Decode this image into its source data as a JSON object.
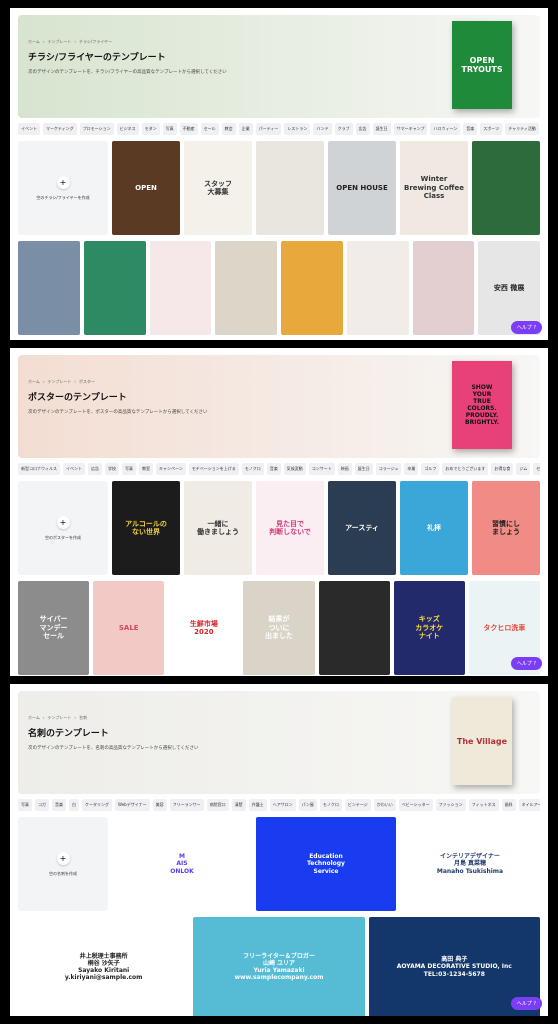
{
  "panels": [
    {
      "crumbs": [
        "ホーム",
        "›",
        "テンプレート",
        "›",
        "チラシ/フライヤー"
      ],
      "title": "チラシ/フライヤーのテンプレート",
      "subtitle": "次のデザインのテンプレートを、チラシ/フライヤーの高品質なテンプレートから選択してください",
      "banner_bg": "#d7e4cf",
      "hero": {
        "text": "OPEN\nTRYOUTS",
        "bg": "#1f8a3a",
        "color": "#ffffff"
      },
      "tags": [
        "イベント",
        "マーケティング",
        "プロモーション",
        "ビジネス",
        "モダン",
        "写真",
        "不動産",
        "セール",
        "教会",
        "企業",
        "パーティー",
        "レストラン",
        "バンド",
        "クラブ",
        "広告",
        "誕生日",
        "サマーキャンプ",
        "ハロウィーン",
        "音楽",
        "スポーツ",
        "チャリティ活動",
        "ポス"
      ],
      "create_label": "空のチラシ/フライヤーを作成",
      "row1": [
        {
          "text": "OPEN",
          "bg": "#5a3a22",
          "color": "#fff"
        },
        {
          "text": "スタッフ\n大募集",
          "bg": "#f4f1ea",
          "color": "#333"
        },
        {
          "text": "",
          "bg": "#e9e6e0",
          "color": "#333"
        },
        {
          "text": "OPEN HOUSE",
          "bg": "#cfd3d6",
          "color": "#222"
        },
        {
          "text": "Winter\nBrewing Coffee Class",
          "bg": "#efe9e1",
          "color": "#333"
        },
        {
          "text": "",
          "bg": "#2e6b3a",
          "color": "#fff"
        }
      ],
      "row2": [
        {
          "text": "",
          "bg": "#7a8ea6",
          "color": "#fff"
        },
        {
          "text": "",
          "bg": "#2e8a62",
          "color": "#fff"
        },
        {
          "text": "",
          "bg": "#f6e7e9",
          "color": "#333"
        },
        {
          "text": "",
          "bg": "#ddd6c8",
          "color": "#333"
        },
        {
          "text": "",
          "bg": "#e8a93c",
          "color": "#333"
        },
        {
          "text": "",
          "bg": "#f2ece8",
          "color": "#333"
        },
        {
          "text": "",
          "bg": "#e4cfd0",
          "color": "#333"
        },
        {
          "text": "安西 微展",
          "bg": "#e6e6e6",
          "color": "#222"
        }
      ]
    },
    {
      "crumbs": [
        "ホーム",
        "›",
        "テンプレート",
        "›",
        "ポスター"
      ],
      "title": "ポスターのテンプレート",
      "subtitle": "次のデザインのテンプレートを、ポスターの高品質なテンプレートから選択してください",
      "banner_bg": "#f3ddd2",
      "hero": {
        "text": "SHOW\nYOUR\nTRUE\nCOLORS.\nPROUDLY.\nBRIGHTLY.",
        "bg": "#e8417a",
        "color": "#111111"
      },
      "tags": [
        "新型コロナウィルス",
        "イベント",
        "広告",
        "学校",
        "写真",
        "教室",
        "キャンペーン",
        "モチベーションを上げる",
        "モノクロ",
        "音楽",
        "気候変動",
        "コンサート",
        "映画",
        "誕生日",
        "コラージュ",
        "卒業",
        "ゴルフ",
        "おめでとうございます",
        "お得な食",
        "ジム",
        "セール"
      ],
      "create_label": "空のポスターを作成",
      "row1": [
        {
          "text": "アルコールの\nない世界",
          "bg": "#1c1c1c",
          "color": "#f5d23a"
        },
        {
          "text": "一緒に\n働きましょう",
          "bg": "#f0ebe4",
          "color": "#333"
        },
        {
          "text": "見た目で\n判断しないで",
          "bg": "#fbeef3",
          "color": "#d23a7a"
        },
        {
          "text": "アースティ",
          "bg": "#2a3d52",
          "color": "#fff"
        },
        {
          "text": "礼拝",
          "bg": "#39a8d8",
          "color": "#fff"
        },
        {
          "text": "習慣にし\nましょう",
          "bg": "#f08b86",
          "color": "#222"
        }
      ],
      "row2": [
        {
          "text": "サイバー\nマンデー\nセール",
          "bg": "#8c8c8c",
          "color": "#fff"
        },
        {
          "text": "SALE",
          "bg": "#f3c9c6",
          "color": "#d04a5a"
        },
        {
          "text": "生鮮市場\n2020",
          "bg": "#ffffff",
          "color": "#d0262a"
        },
        {
          "text": "結果が\nついに\n出ました",
          "bg": "#d9d3c8",
          "color": "#fff"
        },
        {
          "text": "",
          "bg": "#2a2a2a",
          "color": "#e7ff3a"
        },
        {
          "text": "キッズ\nカラオケ\nナイト",
          "bg": "#232a6b",
          "color": "#ffdf3a"
        },
        {
          "text": "タクヒロ洗車",
          "bg": "#eaf4f4",
          "color": "#e5443a"
        }
      ]
    },
    {
      "crumbs": [
        "ホーム",
        "›",
        "テンプレート",
        "›",
        "名刺"
      ],
      "title": "名刺のテンプレート",
      "subtitle": "次のデザインのテンプレートを、名刺の高品質なテンプレートから選択してください",
      "banner_bg": "#eeede9",
      "hero": {
        "text": "The Village",
        "bg": "#efe9d9",
        "color": "#b3323a"
      },
      "tags": [
        "写真",
        "コガ",
        "音楽",
        "白",
        "ケータリング",
        "Webデザイナー",
        "美容",
        "フリーランサー",
        "病院窓口",
        "清楚",
        "弁護士",
        "ヘアサロン",
        "パン屋",
        "モノクロ",
        "ビンテージ",
        "かわいい",
        "ベビーシッター",
        "ファッション",
        "フィットネス",
        "歯科",
        "ネイルアート"
      ],
      "create_label": "空の名刺を作成",
      "row1": [
        {
          "text": "M\nAIS\nONLOK",
          "bg": "#ffffff",
          "color": "#5b3cf0"
        },
        {
          "text": "Education\nTechnology\nService",
          "bg": "#1a3cf0",
          "color": "#ffffff"
        },
        {
          "text": "インテリアデザイナー\n月島 真菜穂\nManaho Tsukishima",
          "bg": "#ffffff",
          "color": "#1f3a6b"
        }
      ],
      "row2": [
        {
          "text": "井上税理士事務所\n桐谷 沙矢子\nSayako Kiritani\ny.kiriyani@sample.com",
          "bg": "#ffffff",
          "color": "#222"
        },
        {
          "text": "フリーライター＆ブロガー\n山崎 ユリア\nYuria Yamazaki\nwww.samplecompany.com",
          "bg": "#56bcd6",
          "color": "#ffffff"
        },
        {
          "text": "高田 典子\nAOYAMA DECORATIVE STUDIO, Inc\nTEL:03-1234-5678",
          "bg": "#13376b",
          "color": "#ffffff"
        }
      ]
    }
  ],
  "help_label": "ヘルプ ?",
  "more_icon": "›"
}
